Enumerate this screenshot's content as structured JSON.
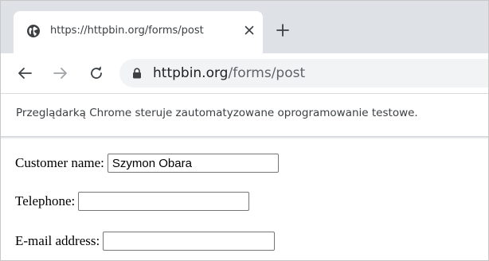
{
  "browser": {
    "tab": {
      "title": "https://httpbin.org/forms/post",
      "favicon": "globe-icon",
      "close_icon": "close-icon"
    },
    "new_tab_icon": "plus-icon",
    "nav": {
      "back_icon": "arrow-left-icon",
      "forward_icon": "arrow-right-icon",
      "reload_icon": "reload-icon"
    },
    "address_bar": {
      "lock_icon": "lock-icon",
      "host": "httpbin.org",
      "path": "/forms/post"
    },
    "infobar": {
      "message": "Przeglądarką Chrome steruje zautomatyzowane oprogramowanie testowe."
    },
    "colors": {
      "tab_strip": "#dee1e6",
      "omnibox": "#f1f3f4",
      "text_primary": "#202124",
      "text_secondary": "#5f6368"
    }
  },
  "form": {
    "customer_name": {
      "label": "Customer name:",
      "value": "Szymon Obara"
    },
    "telephone": {
      "label": "Telephone:",
      "value": ""
    },
    "email": {
      "label": "E-mail address:",
      "value": ""
    }
  }
}
